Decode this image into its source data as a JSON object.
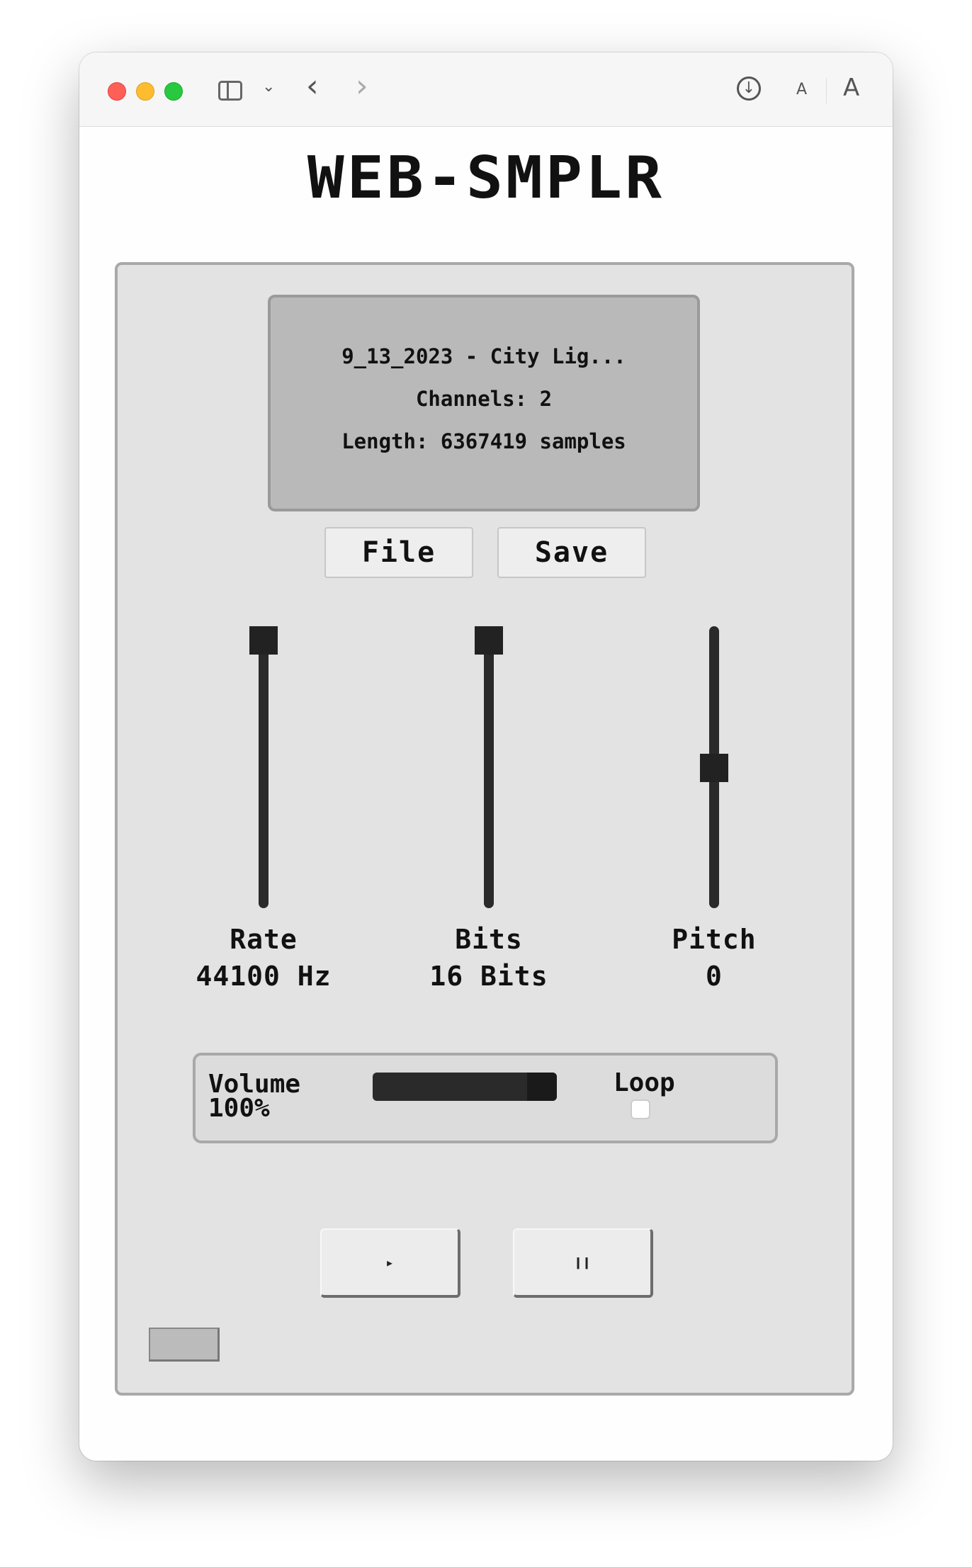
{
  "app": {
    "title": "WEB-SMPLR"
  },
  "toolbar": {
    "icons": [
      "sidebar-icon",
      "chevron-down-icon",
      "back-icon",
      "forward-icon",
      "download-icon",
      "font-smaller-icon",
      "font-larger-icon"
    ],
    "font_small_label": "A",
    "font_large_label": "A"
  },
  "display": {
    "filename": "9_13_2023 - City Lig...",
    "channels": "Channels: 2",
    "length": "Length: 6367419 samples"
  },
  "buttons": {
    "file": "File",
    "save": "Save"
  },
  "sliders": [
    {
      "label": "Rate",
      "value": "44100 Hz",
      "level": 1.0
    },
    {
      "label": "Bits",
      "value": "16 Bits",
      "level": 1.0
    },
    {
      "label": "Pitch",
      "value": "0",
      "level": 0.5
    }
  ],
  "volume": {
    "label": "Volume",
    "value": "100%",
    "level": 1.0
  },
  "loop": {
    "label": "Loop",
    "checked": false
  },
  "transport": {
    "play_symbol": "▸",
    "pause_symbol": "❙❙"
  },
  "colors": {
    "panel": "#e3e3e3",
    "display": "#b9b9b9",
    "track": "#2a2a2a",
    "text": "#111111"
  }
}
